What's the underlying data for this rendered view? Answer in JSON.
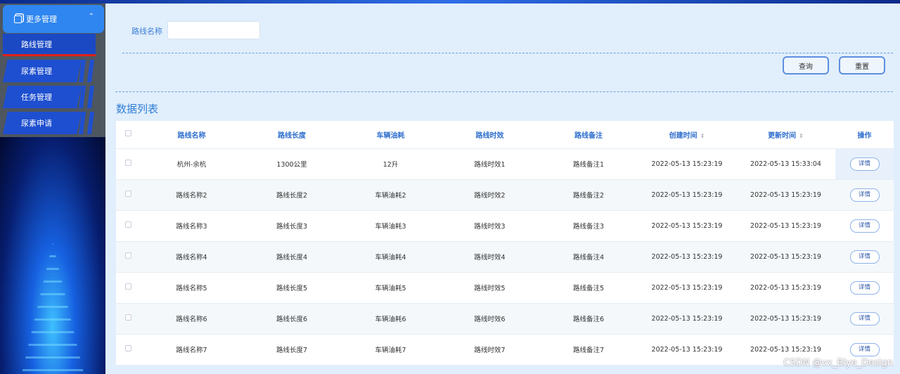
{
  "sidebar": {
    "group": "更多管理",
    "items": [
      "路线管理",
      "尿素管理",
      "任务管理",
      "尿素申请"
    ]
  },
  "search": {
    "label": "路线名称",
    "value": "",
    "query_btn": "查询",
    "reset_btn": "重置"
  },
  "section_title": "数据列表",
  "table": {
    "headers": [
      "路线名称",
      "路线长度",
      "车辆油耗",
      "路线时效",
      "路线备注",
      "创建时间",
      "更新时间",
      "操作"
    ],
    "rows": [
      [
        "杭州-余杭",
        "1300公里",
        "12升",
        "路线时效1",
        "路线备注1",
        "2022-05-13 15:23:19",
        "2022-05-13 15:33:04"
      ],
      [
        "路线名称2",
        "路线长度2",
        "车辆油耗2",
        "路线时效2",
        "路线备注2",
        "2022-05-13 15:23:19",
        "2022-05-13 15:23:19"
      ],
      [
        "路线名称3",
        "路线长度3",
        "车辆油耗3",
        "路线时效3",
        "路线备注3",
        "2022-05-13 15:23:19",
        "2022-05-13 15:23:19"
      ],
      [
        "路线名称4",
        "路线长度4",
        "车辆油耗4",
        "路线时效4",
        "路线备注4",
        "2022-05-13 15:23:19",
        "2022-05-13 15:23:19"
      ],
      [
        "路线名称5",
        "路线长度5",
        "车辆油耗5",
        "路线时效5",
        "路线备注5",
        "2022-05-13 15:23:19",
        "2022-05-13 15:23:19"
      ],
      [
        "路线名称6",
        "路线长度6",
        "车辆油耗6",
        "路线时效6",
        "路线备注6",
        "2022-05-13 15:23:19",
        "2022-05-13 15:23:19"
      ],
      [
        "路线名称7",
        "路线长度7",
        "车辆油耗7",
        "路线时效7",
        "路线备注7",
        "2022-05-13 15:23:19",
        "2022-05-13 15:23:19"
      ]
    ],
    "detail_btn": "详情"
  },
  "watermark": "CSDN @vx_Biye_Design"
}
